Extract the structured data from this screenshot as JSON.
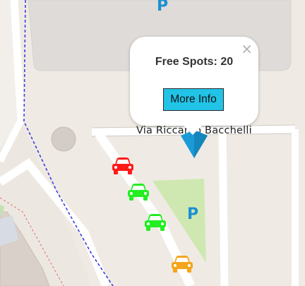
{
  "popup": {
    "title": "Free Spots: 20",
    "button_label": "More Info",
    "close_symbol": "×"
  },
  "street": {
    "label": "Via Riccardo Bacchelli"
  },
  "parking_symbols": [
    "P",
    "P"
  ],
  "marker": {
    "color": "#1a9bd7"
  },
  "cars": [
    {
      "status": "occupied",
      "color": "#ff1a1a"
    },
    {
      "status": "free",
      "color": "#22ee22"
    },
    {
      "status": "free",
      "color": "#22ee22"
    },
    {
      "status": "reserved",
      "color": "#f4a51c"
    }
  ],
  "icons": [
    "close-icon",
    "map-marker-icon",
    "car-icon",
    "parking-icon"
  ]
}
